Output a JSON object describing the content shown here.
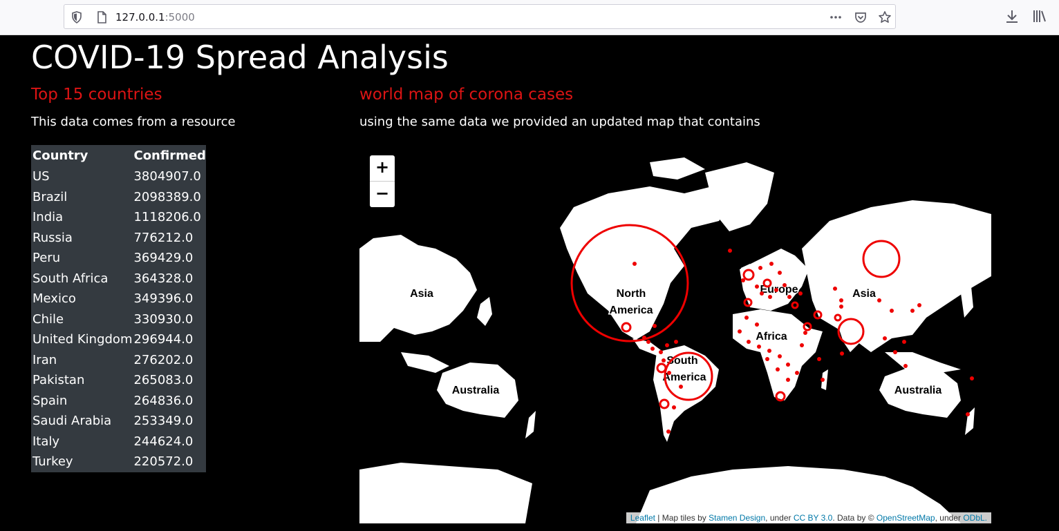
{
  "browser": {
    "url_host": "127.0.0.1",
    "url_port": ":5000"
  },
  "page": {
    "title": "COVID-19 Spread Analysis"
  },
  "left": {
    "heading": "Top 15 countries",
    "description": "This data comes from a resource",
    "table": {
      "headers": [
        "Country",
        "Confirmed"
      ],
      "rows": [
        [
          "US",
          "3804907.0"
        ],
        [
          "Brazil",
          "2098389.0"
        ],
        [
          "India",
          "1118206.0"
        ],
        [
          "Russia",
          "776212.0"
        ],
        [
          "Peru",
          "369429.0"
        ],
        [
          "South Africa",
          "364328.0"
        ],
        [
          "Mexico",
          "349396.0"
        ],
        [
          "Chile",
          "330930.0"
        ],
        [
          "United Kingdom",
          "296944.0"
        ],
        [
          "Iran",
          "276202.0"
        ],
        [
          "Pakistan",
          "265083.0"
        ],
        [
          "Spain",
          "264836.0"
        ],
        [
          "Saudi Arabia",
          "253349.0"
        ],
        [
          "Italy",
          "244624.0"
        ],
        [
          "Turkey",
          "220572.0"
        ]
      ]
    }
  },
  "right": {
    "heading": "world map of corona cases",
    "description": "using the same data we provided an updated map that contains"
  },
  "map": {
    "zoom_in": "+",
    "zoom_out": "−",
    "labels": {
      "asia_left": "Asia",
      "north_america_1": "North",
      "north_america_2": "America",
      "europe": "Europe",
      "africa": "Africa",
      "asia_right": "Asia",
      "south_america_1": "South",
      "south_america_2": "America",
      "australia_left": "Australia",
      "australia_right": "Australia"
    },
    "attribution": {
      "leaflet": "Leaflet",
      "sep1": " | Map tiles by ",
      "stamen": "Stamen Design",
      "sep2": ", under ",
      "ccby": "CC BY 3.0",
      "sep3": ". Data by © ",
      "osm": "OpenStreetMap",
      "sep4": ", under ",
      "odbl": "ODbL."
    }
  },
  "colors": {
    "accent_red": "#dc1414",
    "marker_red": "#ee0000",
    "table_bg": "#343a40"
  }
}
